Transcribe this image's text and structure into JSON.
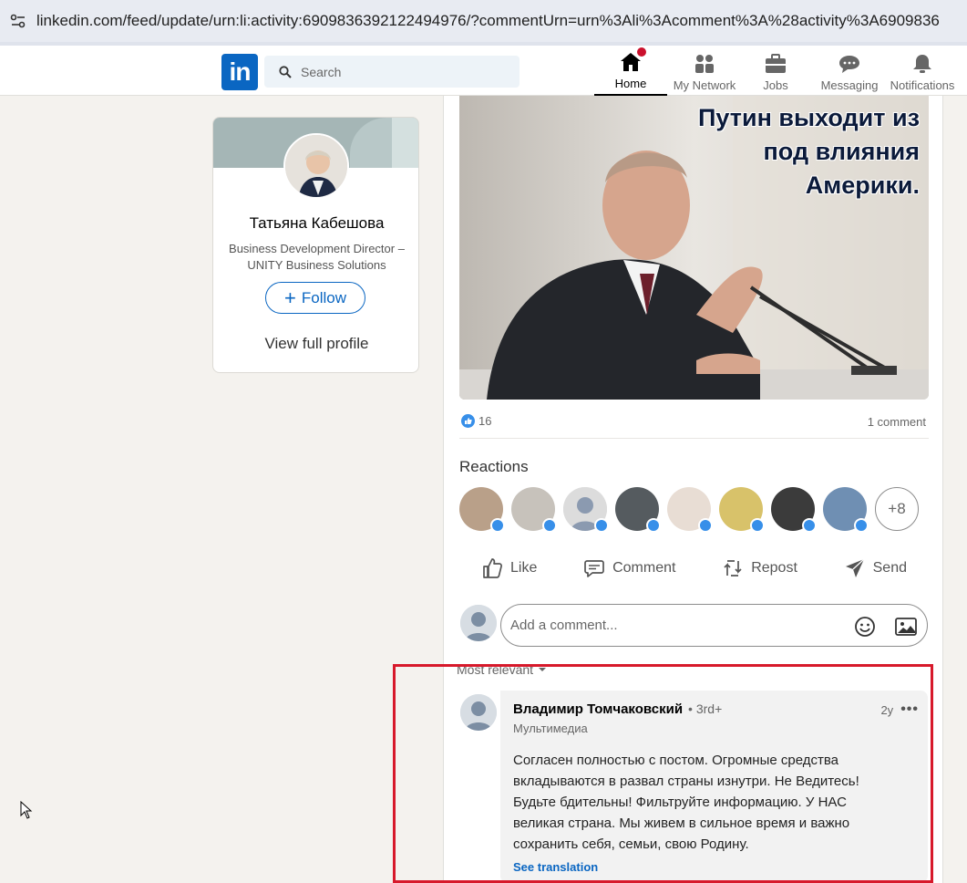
{
  "browser": {
    "url": "linkedin.com/feed/update/urn:li:activity:6909836392122494976/?commentUrn=urn%3Ali%3Acomment%3A%28activity%3A6909836"
  },
  "header": {
    "logo": "in",
    "search_placeholder": "Search",
    "nav": [
      {
        "label": "Home",
        "icon": "home-icon",
        "active": true
      },
      {
        "label": "My Network",
        "icon": "network-icon"
      },
      {
        "label": "Jobs",
        "icon": "briefcase-icon"
      },
      {
        "label": "Messaging",
        "icon": "messaging-icon"
      },
      {
        "label": "Notifications",
        "icon": "bell-icon"
      }
    ]
  },
  "profile": {
    "name": "Татьяна Кабешова",
    "headline": "Business Development Director – UNITY Business Solutions",
    "follow_label": "Follow",
    "view_profile_label": "View full profile"
  },
  "post": {
    "image_caption_lines": [
      "Путин выходит из",
      "под влияния",
      "Америки."
    ],
    "reaction_count": "16",
    "comment_count": "1 comment",
    "reactions_title": "Reactions",
    "more_reactors": "+8",
    "actions": {
      "like": "Like",
      "comment": "Comment",
      "repost": "Repost",
      "send": "Send"
    },
    "comment_placeholder": "Add a comment...",
    "sort_label": "Most relevant"
  },
  "comment": {
    "author": "Владимир Томчаковский",
    "degree": "• 3rd+",
    "time": "2y",
    "headline": "Мультимедиа",
    "text": "Согласен полностью с постом. Огромные средства вкладываются в развал страны изнутри. Не Ведитесь! Будьте бдительны! Фильтруйте информацию. У НАС великая страна. Мы живем в сильное время и важно сохранить себя, семьи, свою Родину.",
    "translate_label": "See translation"
  },
  "colors": {
    "brand": "#0a66c2",
    "highlight": "#d7192b",
    "like": "#378fe9"
  }
}
